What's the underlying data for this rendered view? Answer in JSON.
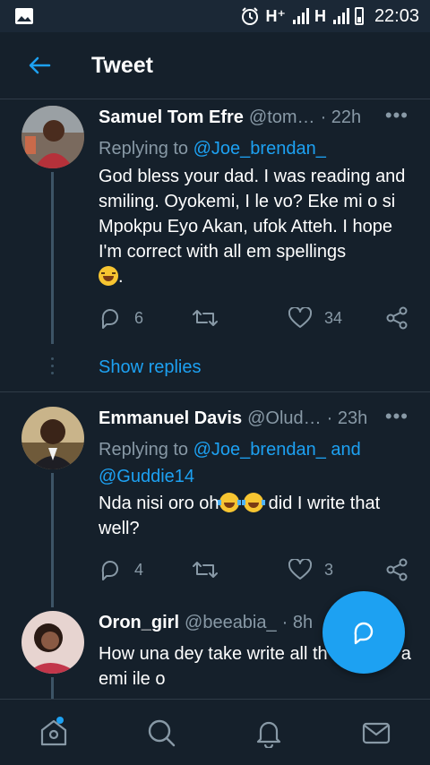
{
  "status_bar": {
    "network_1": "H⁺",
    "network_2": "H",
    "time": "22:03"
  },
  "header": {
    "title": "Tweet"
  },
  "tweets": [
    {
      "name": "Samuel Tom Efre",
      "handle": "@tom…",
      "time": "· 22h",
      "replying_prefix": "Replying to",
      "replying_to": "@Joe_brendan_",
      "replying_to_2": "",
      "text": "God bless your dad. I was reading and smiling. Oyokemi, I le vo?  Eke mi o si Mpokpu Eyo Akan, ufok Atteh. I hope I'm correct with all em spellings",
      "text_suffix": ".",
      "replies": "6",
      "retweets": "",
      "likes": "34"
    },
    {
      "name": "Emmanuel Davis",
      "handle": "@Olud…",
      "time": "· 23h",
      "replying_prefix": "Replying to",
      "replying_to": "@Joe_brendan_ and",
      "replying_to_2": "@Guddie14",
      "text_a": "Nda nisi oro oh",
      "text_b": " did I write that well?",
      "replies": "4",
      "retweets": "",
      "likes": "3"
    },
    {
      "name": "Oron_girl",
      "handle": "@beeabia_",
      "time": "· 8h",
      "text_line1": "How una dey take write all th",
      "text_line1_end": "a",
      "text_line2": "emi ile o"
    }
  ],
  "show_replies": "Show replies",
  "more_label": "•••",
  "colors": {
    "accent": "#1da1f2",
    "background": "#15202b",
    "muted": "#8899a6"
  },
  "icons": [
    "back-arrow-icon",
    "reply-icon",
    "retweet-icon",
    "like-icon",
    "share-icon",
    "compose-reply-icon",
    "home-icon",
    "search-icon",
    "notifications-icon",
    "messages-icon"
  ]
}
